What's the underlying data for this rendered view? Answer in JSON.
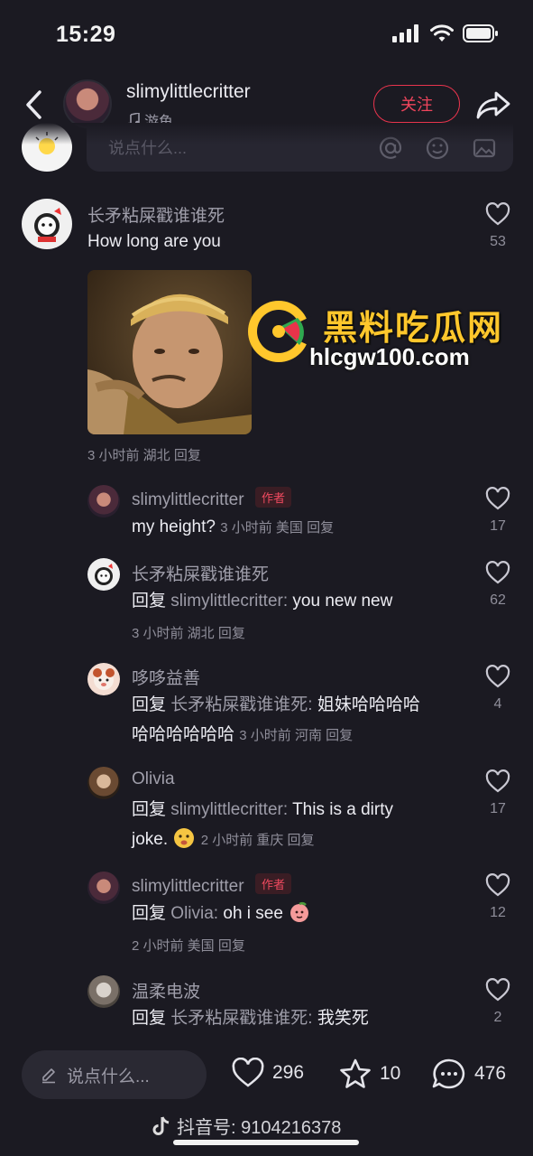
{
  "status_bar": {
    "time": "15:29"
  },
  "header": {
    "username": "slimylittlecritter",
    "music_label": "游鱼",
    "follow_label": "关注"
  },
  "comment_input": {
    "placeholder": "说点什么..."
  },
  "comments": [
    {
      "user": "长矛粘屎戳谁谁死",
      "text": "How long are you",
      "likes": "53",
      "meta": "3 小时前 湖北 回复"
    }
  ],
  "replies": [
    {
      "user": "slimylittlecritter",
      "author_badge": "作者",
      "text": "my height?",
      "meta": "3 小时前 美国 回复",
      "likes": "17"
    },
    {
      "user": "长矛粘屎戳谁谁死",
      "reply_prefix": "回复",
      "reply_to": "slimylittlecritter:",
      "text": "you new new",
      "meta": "3 小时前 湖北 回复",
      "likes": "62"
    },
    {
      "user": "哆哆益善",
      "reply_prefix": "回复",
      "reply_to": "长矛粘屎戳谁谁死:",
      "text": "姐妹哈哈哈哈",
      "text2": "哈哈哈哈哈哈",
      "meta": "3 小时前 河南 回复",
      "likes": "4"
    },
    {
      "user": "Olivia",
      "reply_prefix": "回复",
      "reply_to": "slimylittlecritter:",
      "text": "This is a dirty",
      "text2": "joke.",
      "meta": "2 小时前 重庆 回复",
      "likes": "17"
    },
    {
      "user": "slimylittlecritter",
      "author_badge": "作者",
      "reply_prefix": "回复",
      "reply_to": "Olivia:",
      "text": "oh i see",
      "meta": "2 小时前 美国 回复",
      "likes": "12"
    },
    {
      "user": "温柔电波",
      "reply_prefix": "回复",
      "reply_to": "长矛粘屎戳谁谁死:",
      "text": "我笑死",
      "likes": "2"
    }
  ],
  "watermark": {
    "title": "黑料吃瓜网",
    "url": "hlcgw100.com"
  },
  "bottom_bar": {
    "input_placeholder": "说点什么...",
    "likes": "296",
    "favorites": "10",
    "comments": "476"
  },
  "tiktok_watermark": "抖音号: 9104216378",
  "colors": {
    "background": "#1b1a22",
    "accent": "#e8344d",
    "watermark_yellow": "#ffc72c"
  }
}
